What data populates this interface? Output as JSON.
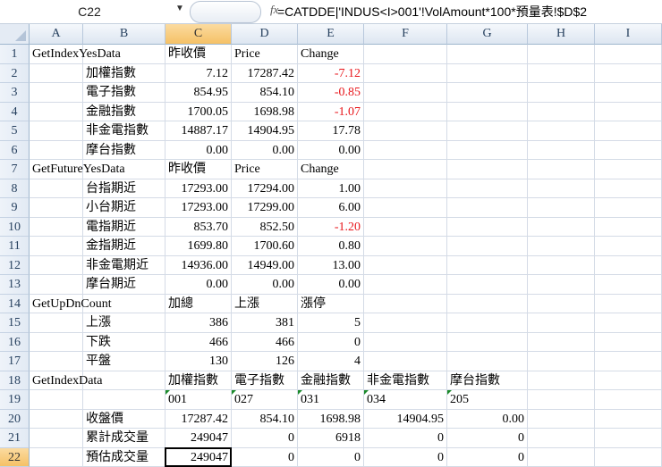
{
  "formula_bar": {
    "name_box": "C22",
    "fx_label": "fx",
    "formula": "=CATDDE|'INDUS<I>001'!VolAmount*100*預量表!$D$2"
  },
  "columns": [
    "A",
    "B",
    "C",
    "D",
    "E",
    "F",
    "G",
    "H",
    "I"
  ],
  "selected_column": "C",
  "selected_row": 22,
  "active_cell": "C22",
  "colors": {
    "negative": "#e8161b",
    "selection_header": "#f5c166"
  },
  "rows": [
    {
      "n": "1",
      "cells": [
        [
          "A",
          "GetIndexYesData",
          "l"
        ],
        [
          "C",
          "昨收價",
          "l"
        ],
        [
          "D",
          "Price",
          "l"
        ],
        [
          "E",
          "Change",
          "l"
        ]
      ]
    },
    {
      "n": "2",
      "cells": [
        [
          "B",
          "加權指數",
          "l"
        ],
        [
          "C",
          "7.12",
          "r"
        ],
        [
          "D",
          "17287.42",
          "r"
        ],
        [
          "E",
          "-7.12",
          "r",
          "red"
        ]
      ]
    },
    {
      "n": "3",
      "cells": [
        [
          "B",
          "電子指數",
          "l"
        ],
        [
          "C",
          "854.95",
          "r"
        ],
        [
          "D",
          "854.10",
          "r"
        ],
        [
          "E",
          "-0.85",
          "r",
          "red"
        ]
      ]
    },
    {
      "n": "4",
      "cells": [
        [
          "B",
          "金融指數",
          "l"
        ],
        [
          "C",
          "1700.05",
          "r"
        ],
        [
          "D",
          "1698.98",
          "r"
        ],
        [
          "E",
          "-1.07",
          "r",
          "red"
        ]
      ]
    },
    {
      "n": "5",
      "cells": [
        [
          "B",
          "非金電指數",
          "l"
        ],
        [
          "C",
          "14887.17",
          "r"
        ],
        [
          "D",
          "14904.95",
          "r"
        ],
        [
          "E",
          "17.78",
          "r"
        ]
      ]
    },
    {
      "n": "6",
      "cells": [
        [
          "B",
          "摩台指數",
          "l"
        ],
        [
          "C",
          "0.00",
          "r"
        ],
        [
          "D",
          "0.00",
          "r"
        ],
        [
          "E",
          "0.00",
          "r"
        ]
      ]
    },
    {
      "n": "7",
      "cells": [
        [
          "A",
          "GetFutureYesData",
          "l"
        ],
        [
          "C",
          "昨收價",
          "l"
        ],
        [
          "D",
          "Price",
          "l"
        ],
        [
          "E",
          "Change",
          "l"
        ]
      ]
    },
    {
      "n": "8",
      "cells": [
        [
          "B",
          "台指期近",
          "l"
        ],
        [
          "C",
          "17293.00",
          "r"
        ],
        [
          "D",
          "17294.00",
          "r"
        ],
        [
          "E",
          "1.00",
          "r"
        ]
      ]
    },
    {
      "n": "9",
      "cells": [
        [
          "B",
          "小台期近",
          "l"
        ],
        [
          "C",
          "17293.00",
          "r"
        ],
        [
          "D",
          "17299.00",
          "r"
        ],
        [
          "E",
          "6.00",
          "r"
        ]
      ]
    },
    {
      "n": "10",
      "cells": [
        [
          "B",
          "電指期近",
          "l"
        ],
        [
          "C",
          "853.70",
          "r"
        ],
        [
          "D",
          "852.50",
          "r"
        ],
        [
          "E",
          "-1.20",
          "r",
          "red"
        ]
      ]
    },
    {
      "n": "11",
      "cells": [
        [
          "B",
          "金指期近",
          "l"
        ],
        [
          "C",
          "1699.80",
          "r"
        ],
        [
          "D",
          "1700.60",
          "r"
        ],
        [
          "E",
          "0.80",
          "r"
        ]
      ]
    },
    {
      "n": "12",
      "cells": [
        [
          "B",
          "非金電期近",
          "l"
        ],
        [
          "C",
          "14936.00",
          "r"
        ],
        [
          "D",
          "14949.00",
          "r"
        ],
        [
          "E",
          "13.00",
          "r"
        ]
      ]
    },
    {
      "n": "13",
      "cells": [
        [
          "B",
          "摩台期近",
          "l"
        ],
        [
          "C",
          "0.00",
          "r"
        ],
        [
          "D",
          "0.00",
          "r"
        ],
        [
          "E",
          "0.00",
          "r"
        ]
      ]
    },
    {
      "n": "14",
      "cells": [
        [
          "A",
          "GetUpDnCount",
          "l"
        ],
        [
          "C",
          "加總",
          "l"
        ],
        [
          "D",
          "上漲",
          "l"
        ],
        [
          "E",
          "漲停",
          "l"
        ]
      ]
    },
    {
      "n": "15",
      "cells": [
        [
          "B",
          "上漲",
          "l"
        ],
        [
          "C",
          "386",
          "r"
        ],
        [
          "D",
          "381",
          "r"
        ],
        [
          "E",
          "5",
          "r"
        ]
      ]
    },
    {
      "n": "16",
      "cells": [
        [
          "B",
          "下跌",
          "l"
        ],
        [
          "C",
          "466",
          "r"
        ],
        [
          "D",
          "466",
          "r"
        ],
        [
          "E",
          "0",
          "r"
        ]
      ]
    },
    {
      "n": "17",
      "cells": [
        [
          "B",
          "平盤",
          "l"
        ],
        [
          "C",
          "130",
          "r"
        ],
        [
          "D",
          "126",
          "r"
        ],
        [
          "E",
          "4",
          "r"
        ]
      ]
    },
    {
      "n": "18",
      "cells": [
        [
          "A",
          "GetIndexData",
          "l"
        ],
        [
          "C",
          "加權指數",
          "l"
        ],
        [
          "D",
          "電子指數",
          "l"
        ],
        [
          "E",
          "金融指數",
          "l"
        ],
        [
          "F",
          "非金電指數",
          "l"
        ],
        [
          "G",
          "摩台指數",
          "l"
        ]
      ]
    },
    {
      "n": "19",
      "cells": [
        [
          "C",
          "001",
          "l",
          "tri"
        ],
        [
          "D",
          "027",
          "l",
          "tri"
        ],
        [
          "E",
          "031",
          "l",
          "tri"
        ],
        [
          "F",
          "034",
          "l",
          "tri"
        ],
        [
          "G",
          "205",
          "l",
          "tri"
        ]
      ]
    },
    {
      "n": "20",
      "cells": [
        [
          "B",
          "收盤價",
          "l"
        ],
        [
          "C",
          "17287.42",
          "r"
        ],
        [
          "D",
          "854.10",
          "r"
        ],
        [
          "E",
          "1698.98",
          "r"
        ],
        [
          "F",
          "14904.95",
          "r"
        ],
        [
          "G",
          "0.00",
          "r"
        ]
      ]
    },
    {
      "n": "21",
      "cells": [
        [
          "B",
          "累計成交量",
          "l"
        ],
        [
          "C",
          "249047",
          "r"
        ],
        [
          "D",
          "0",
          "r"
        ],
        [
          "E",
          "6918",
          "r"
        ],
        [
          "F",
          "0",
          "r"
        ],
        [
          "G",
          "0",
          "r"
        ]
      ]
    },
    {
      "n": "22",
      "cells": [
        [
          "B",
          "預估成交量",
          "l"
        ],
        [
          "C",
          "249047",
          "r"
        ],
        [
          "D",
          "0",
          "r"
        ],
        [
          "E",
          "0",
          "r"
        ],
        [
          "F",
          "0",
          "r"
        ],
        [
          "G",
          "0",
          "r"
        ]
      ]
    }
  ]
}
